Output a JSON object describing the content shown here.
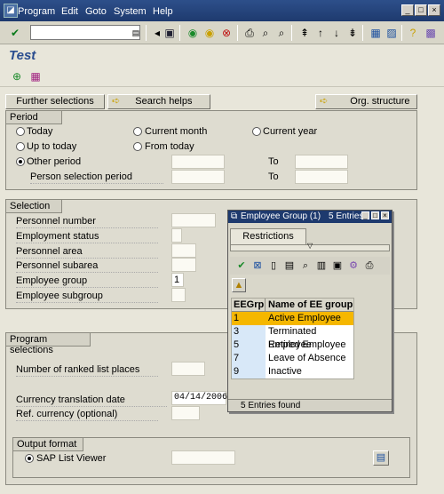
{
  "menu": {
    "items": [
      "Program",
      "Edit",
      "Goto",
      "System",
      "Help"
    ]
  },
  "screen": {
    "title": "Test"
  },
  "buttons": {
    "further_selections": "Further selections",
    "search_helps": "Search helps",
    "org_structure": "Org. structure"
  },
  "period": {
    "title": "Period",
    "today": "Today",
    "current_month": "Current month",
    "current_year": "Current year",
    "up_to_today": "Up to today",
    "from_today": "From today",
    "other_period": "Other period",
    "person_selection_period": "Person selection period",
    "to1": "To",
    "to2": "To"
  },
  "selection": {
    "title": "Selection",
    "fields": [
      "Personnel number",
      "Employment status",
      "Personnel area",
      "Personnel subarea",
      "Employee group",
      "Employee subgroup"
    ],
    "employee_group_value": "1"
  },
  "program_selections": {
    "title": "Program selections",
    "ranked": "Number of ranked list places",
    "currency_date_label": "Currency translation date",
    "currency_date_value": "04/14/2006",
    "ref_currency": "Ref. currency (optional)"
  },
  "output": {
    "title": "Output format",
    "option": "SAP List Viewer"
  },
  "popup": {
    "title": "Employee Group (1)",
    "entries": "5 Entries",
    "tab": "Restrictions",
    "col1": "EEGrp",
    "col2": "Name of EE group",
    "rows": [
      {
        "code": "1",
        "name": "Active Employee"
      },
      {
        "code": "3",
        "name": "Terminated Employee"
      },
      {
        "code": "5",
        "name": "Retired Employee"
      },
      {
        "code": "7",
        "name": "Leave of Absence"
      },
      {
        "code": "9",
        "name": "Inactive"
      }
    ],
    "status": "5 Entries found"
  },
  "colors": {
    "accent": "#1e3a6e",
    "selected_row": "#f5b700",
    "code_cell": "#d8e8f8"
  }
}
